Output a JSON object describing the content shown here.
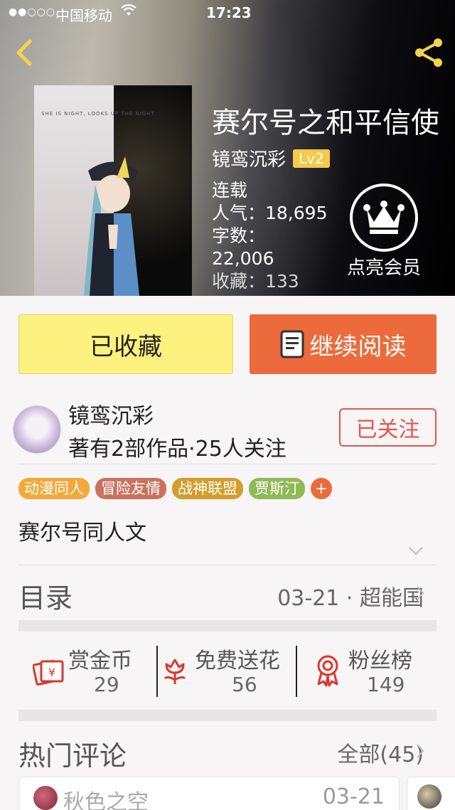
{
  "status_bar": {
    "signal": "●●○○○",
    "carrier": "中国移动",
    "wifi": "wifi-icon",
    "time": "17:23"
  },
  "header": {
    "back_icon": "chevron-left-icon",
    "share_icon": "share-icon"
  },
  "cover": {
    "tagline": "SHE IS NIGHT, LOOKS UP THE NIGHT."
  },
  "book": {
    "title": "赛尔号之和平信使",
    "author": "镜鸾沉彩",
    "level": "Lv2",
    "status": "连载",
    "popularity": "人气：18,695",
    "word_label": "字数：",
    "word_count": "22,006",
    "favorites_partial": "收藏：133"
  },
  "member": {
    "label": "点亮会员",
    "icon": "crown-icon"
  },
  "buttons": {
    "favorited": "已收藏",
    "continue_reading": "继续阅读"
  },
  "author_card": {
    "name": "镜鸾沉彩",
    "stats": "著有2部作品·25人关注",
    "follow": "已关注"
  },
  "tags": [
    {
      "label": "动漫同人",
      "color": "#f3a83b"
    },
    {
      "label": "冒险友情",
      "color": "#c9735f"
    },
    {
      "label": "战神联盟",
      "color": "#d39d2e"
    },
    {
      "label": "贾斯汀",
      "color": "#8fba56"
    }
  ],
  "tag_add": "+",
  "description": "赛尔号同人文",
  "toc": {
    "label": "目录",
    "latest": "03-21 · 超能国"
  },
  "actions": [
    {
      "label": "赏金币",
      "count": "29",
      "icon": "red-envelope-icon"
    },
    {
      "label": "免费送花",
      "count": "56",
      "icon": "flower-icon"
    },
    {
      "label": "粉丝榜",
      "count": "149",
      "icon": "medal-icon"
    }
  ],
  "comments": {
    "label": "热门评论",
    "all": "全部(45)",
    "items": [
      {
        "user": "秋色之空",
        "date": "03-21"
      }
    ]
  },
  "colors": {
    "accent": "#ec6a3b",
    "favorite_button": "#fdf17f",
    "follow": "#e3554b",
    "level_badge": "#f6c94b"
  }
}
